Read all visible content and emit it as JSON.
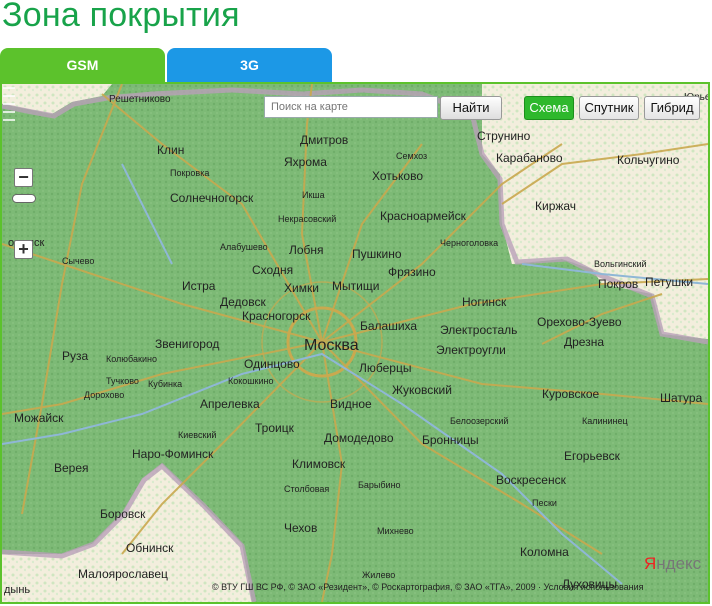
{
  "title": "Зона покрытия",
  "tabs": {
    "gsm": "GSM",
    "g3": "3G"
  },
  "search": {
    "placeholder": "Поиск на карте",
    "button": "Найти"
  },
  "map_types": {
    "scheme": "Схема",
    "satellite": "Спутник",
    "hybrid": "Гибрид"
  },
  "zoom": {
    "minus": "−",
    "plus": "+"
  },
  "copyright": "© ВТУ ГШ ВС РФ, © ЗАО «Резидент», © Роскартография, © ЗАО «ТГА», 2009 · Условия использования",
  "brand": {
    "y": "Я",
    "rest": "ндекс"
  },
  "colors": {
    "coverage": "#7fb776",
    "outside": "#f4efdf",
    "accent_green": "#18a34a",
    "tab_gsm": "#5cc22c",
    "tab_3g": "#1c98e6"
  },
  "places": {
    "reshetnikovo": "Решетниково",
    "dmitrov": "Дмитров",
    "strunino": "Струнино",
    "yuryev": "Юрьев",
    "klin": "Клин",
    "yakhroma": "Яхрома",
    "semkhoz": "Семхоз",
    "karabanovo": "Караба­ново",
    "kolchugino": "Кольчугино",
    "pokrovka": "Покровка",
    "khotkovo": "Хотьково",
    "solnechnogorsk": "Солнечногорск",
    "iksha": "Икша",
    "kirzhach": "Киржач",
    "nekrasovsky": "Некрасовский",
    "krasnoarmeysk": "Красноармейск",
    "alabushevo": "Алабушево",
    "volamsk": "оламск",
    "chernogolovka": "Черноголовка",
    "lobnya": "Лобня",
    "pushkino": "Пушкино",
    "sychevo": "Сычево",
    "skhodnya": "Сходня",
    "khimki": "Химки",
    "fryazino": "Фрязино",
    "volginsky": "Вольгинский",
    "istra": "Истра",
    "mytishchi": "Мытищи",
    "pokrov": "Покров",
    "petushki": "Петушки",
    "dedovsk": "Дедовск",
    "noginsk": "Ногинск",
    "krasnogorsk": "Красногорск",
    "balashikha": "Балашиха",
    "elektrostal": "Электросталь",
    "orekhovo": "Орехово-Зуево",
    "zvenigorod": "Звенигород",
    "moskva": "Москва",
    "dresna": "Дрезна",
    "ruza": "Руза",
    "kolyubakino": "Колюбакино",
    "odintsovo": "Одинцово",
    "elektrougli": "Электроугли",
    "lyubertsy": "Люберцы",
    "tuchkovo": "Тучково",
    "kubinka": "Кубинка",
    "kokoshkino": "Кокошкино",
    "zhukovsky": "Жуковский",
    "dorokhovo": "Дорохово",
    "kurovskoe": "Куровское",
    "mozhaysk": "Можайск",
    "aprelevka": "Апрелевка",
    "vidnoe": "Видное",
    "shatura": "Шатура",
    "beloozersky": "Белоозерский",
    "kievsky": "Киевский",
    "troitsk": "Троицк",
    "vereya": "Верея",
    "domodedovo": "Домодедово",
    "bronnitsy": "Бронницы",
    "naro_fominsk": "Наро-Фоминск",
    "klimovsk": "Климовск",
    "yegoryevsk": "Егорьевск",
    "kalininets": "Калининец",
    "voskresensk": "Воскресенск",
    "stolbovaya": "Столбовая",
    "barybino": "Барыбино",
    "peski": "Пески",
    "borovsk": "Боровск",
    "obninsk": "Обнинск",
    "chekhov": "Чехов",
    "mikhnevo": "Михнево",
    "kolomna": "Коломна",
    "maloyaroslavets": "Малоярославец",
    "zhilevo": "Жилево",
    "lukhovitsy": "Луховицы",
    "dyn": "дынь"
  }
}
